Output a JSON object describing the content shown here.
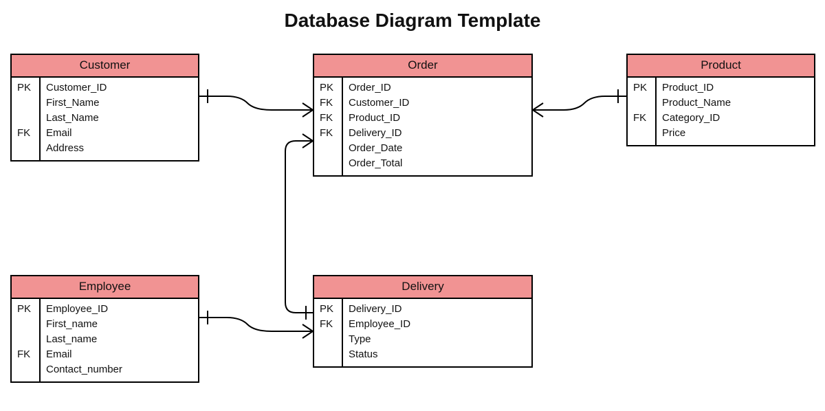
{
  "title": "Database Diagram Template",
  "entities": {
    "customer": {
      "name": "Customer",
      "rows": [
        {
          "key": "PK",
          "field": "Customer_ID"
        },
        {
          "key": "",
          "field": "First_Name"
        },
        {
          "key": "",
          "field": "Last_Name"
        },
        {
          "key": "FK",
          "field": "Email"
        },
        {
          "key": "",
          "field": "Address"
        }
      ]
    },
    "order": {
      "name": "Order",
      "rows": [
        {
          "key": "PK",
          "field": "Order_ID"
        },
        {
          "key": "FK",
          "field": "Customer_ID"
        },
        {
          "key": "FK",
          "field": "Product_ID"
        },
        {
          "key": "FK",
          "field": "Delivery_ID"
        },
        {
          "key": "",
          "field": "Order_Date"
        },
        {
          "key": "",
          "field": "Order_Total"
        }
      ]
    },
    "product": {
      "name": "Product",
      "rows": [
        {
          "key": "PK",
          "field": "Product_ID"
        },
        {
          "key": "",
          "field": "Product_Name"
        },
        {
          "key": "FK",
          "field": "Category_ID"
        },
        {
          "key": "",
          "field": "Price"
        }
      ]
    },
    "employee": {
      "name": "Employee",
      "rows": [
        {
          "key": "PK",
          "field": "Employee_ID"
        },
        {
          "key": "",
          "field": "First_name"
        },
        {
          "key": "",
          "field": "Last_name"
        },
        {
          "key": "FK",
          "field": "Email"
        },
        {
          "key": "",
          "field": "Contact_number"
        }
      ]
    },
    "delivery": {
      "name": "Delivery",
      "rows": [
        {
          "key": "PK",
          "field": "Delivery_ID"
        },
        {
          "key": "FK",
          "field": "Employee_ID"
        },
        {
          "key": "",
          "field": "Type"
        },
        {
          "key": "",
          "field": "Status"
        }
      ]
    }
  },
  "relationships": [
    {
      "from": "customer",
      "to": "order",
      "from_card": "one",
      "to_card": "many"
    },
    {
      "from": "order",
      "to": "product",
      "from_card": "many",
      "to_card": "one"
    },
    {
      "from": "delivery",
      "to": "order",
      "from_card": "one",
      "to_card": "many"
    },
    {
      "from": "employee",
      "to": "delivery",
      "from_card": "one",
      "to_card": "many"
    }
  ]
}
